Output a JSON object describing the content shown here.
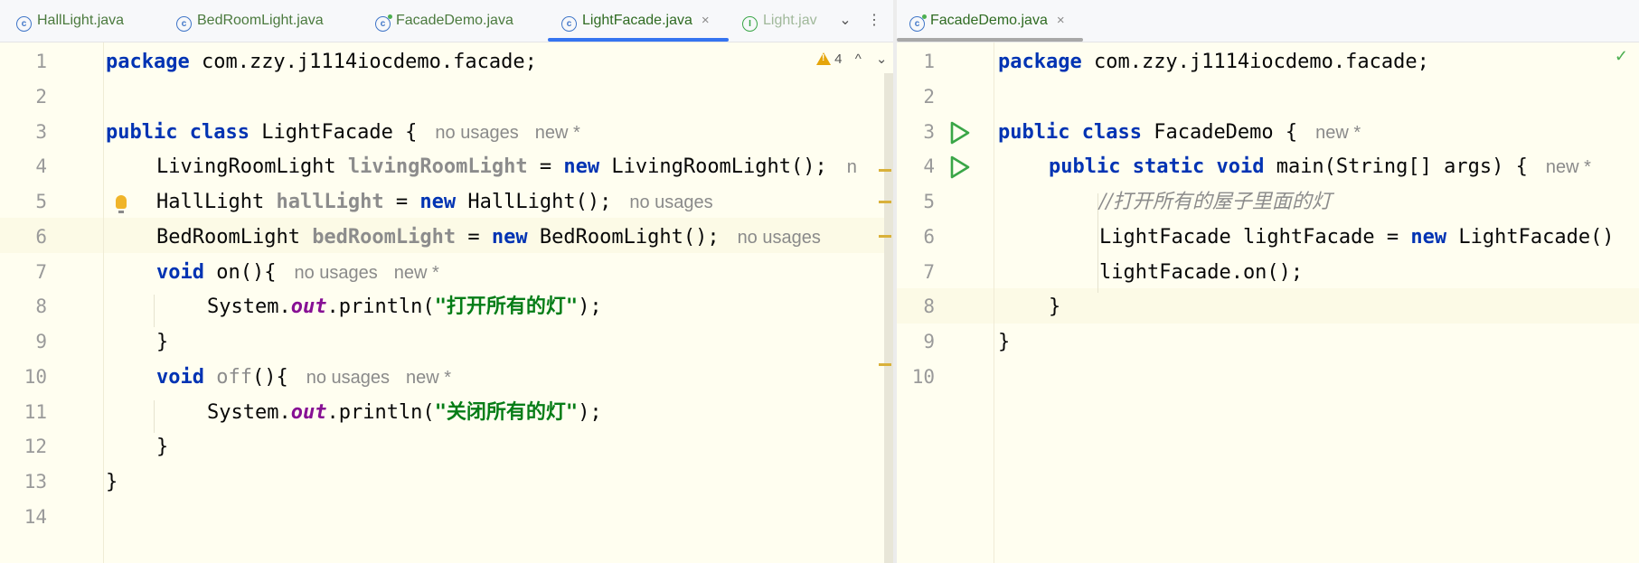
{
  "left": {
    "tabs": [
      {
        "label": "HallLight.java",
        "icon": "class-icon"
      },
      {
        "label": "BedRoomLight.java",
        "icon": "class-icon"
      },
      {
        "label": "FacadeDemo.java",
        "icon": "runnable-class-icon"
      },
      {
        "label": "LightFacade.java",
        "icon": "class-icon",
        "active": true
      },
      {
        "label": "Light.jav",
        "icon": "interface-icon"
      }
    ],
    "close_glyph": "×",
    "more_tabs_glyph": "⌄",
    "menu_glyph": "⋮",
    "warnings": {
      "count": "4",
      "up": "^",
      "down": "⌄"
    },
    "line_numbers": [
      "1",
      "2",
      "3",
      "4",
      "5",
      "6",
      "7",
      "8",
      "9",
      "10",
      "11",
      "12",
      "13",
      "14"
    ],
    "code": {
      "l1_kw": "package",
      "l1_rest": " com.zzy.j1114iocdemo.facade;",
      "l3_kw1": "public",
      "l3_kw2": "class",
      "l3_name": " LightFacade {",
      "l3_hint1": "no usages",
      "l3_hint2": "new *",
      "l4_type": "LivingRoomLight ",
      "l4_field": "livingRoomLight",
      "l4_eq": " = ",
      "l4_new": "new",
      "l4_rest": " LivingRoomLight();",
      "l4_hint": "n",
      "l5_type": "HallLight ",
      "l5_field": "hallLight",
      "l5_eq": " = ",
      "l5_new": "new",
      "l5_rest": " HallLight();",
      "l5_hint": "no usages",
      "l6_type": "BedRoomLight ",
      "l6_field": "bedRoomLight",
      "l6_eq": " = ",
      "l6_new": "new",
      "l6_rest": " BedRoomLight();",
      "l6_hint": "no usages",
      "l7_kw": "void",
      "l7_rest": " on(){",
      "l7_hint1": "no usages",
      "l7_hint2": "new *",
      "l8_a": "System.",
      "l8_out": "out",
      "l8_b": ".println(",
      "l8_str": "\"打开所有的灯\"",
      "l8_c": ");",
      "l9": "}",
      "l10_kw": "void",
      "l10_name": "off",
      "l10_rest": "(){",
      "l10_hint1": "no usages",
      "l10_hint2": "new *",
      "l11_a": "System.",
      "l11_out": "out",
      "l11_b": ".println(",
      "l11_str": "\"关闭所有的灯\"",
      "l11_c": ");",
      "l12": "}",
      "l13": "}"
    }
  },
  "right": {
    "tab": {
      "label": "FacadeDemo.java",
      "icon": "runnable-class-icon"
    },
    "close_glyph": "×",
    "status_glyph": "✓",
    "line_numbers": [
      "1",
      "2",
      "3",
      "4",
      "5",
      "6",
      "7",
      "8",
      "9",
      "10"
    ],
    "code": {
      "l1_kw": "package",
      "l1_rest": " com.zzy.j1114iocdemo.facade;",
      "l3_kw1": "public",
      "l3_kw2": "class",
      "l3_name": " FacadeDemo {",
      "l3_hint": "new *",
      "l4_kw1": "public",
      "l4_kw2": "static",
      "l4_kw3": "void",
      "l4_rest": " main(String[] args) {",
      "l4_hint": "new *",
      "l5_comment": "//打开所有的屋子里面的灯",
      "l6_a": "LightFacade lightFacade = ",
      "l6_new": "new",
      "l6_b": " LightFacade()",
      "l7": "lightFacade.on();",
      "l8": "}",
      "l9": "}"
    }
  },
  "colors": {
    "keyword": "#0033b3",
    "string": "#067d17",
    "static_field": "#871094",
    "active_tab_underline": "#3574f0",
    "run_icon": "#3aa647"
  }
}
